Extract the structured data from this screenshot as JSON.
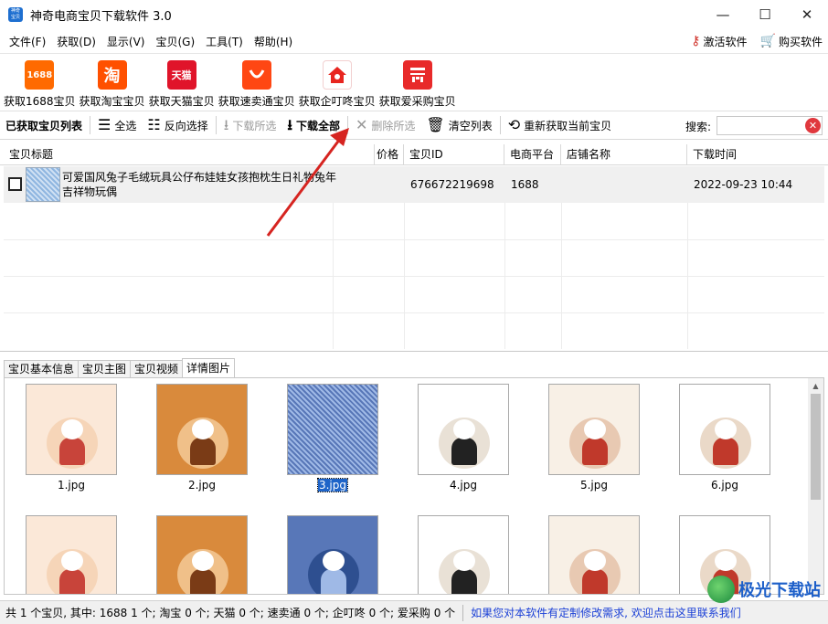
{
  "window": {
    "title": "神奇电商宝贝下载软件 3.0",
    "app_icon_text": "神奇\n宝贝",
    "minimize": "—",
    "maximize": "☐",
    "close": "✕"
  },
  "menu": {
    "items": [
      "文件(F)",
      "获取(D)",
      "显示(V)",
      "宝贝(G)",
      "工具(T)",
      "帮助(H)"
    ],
    "activate": "激活软件",
    "buy": "购买软件"
  },
  "platform_buttons": [
    {
      "label": "获取1688宝贝",
      "icon_text": "1688",
      "icon": "1688-icon",
      "color": "#ff6a00"
    },
    {
      "label": "获取淘宝宝贝",
      "icon_text": "淘",
      "icon": "taobao-icon",
      "color": "#ff5000"
    },
    {
      "label": "获取天猫宝贝",
      "icon_text": "天猫",
      "icon": "tmall-icon",
      "color": "#e0142a"
    },
    {
      "label": "获取速卖通宝贝",
      "icon_text": "",
      "icon": "aliexpress-icon",
      "color": "#ff4713"
    },
    {
      "label": "获取企叮咚宝贝",
      "icon_text": "",
      "icon": "qidingdong-icon",
      "color": "#e8251f"
    },
    {
      "label": "获取爱采购宝贝",
      "icon_text": "",
      "icon": "aicaigou-icon",
      "color": "#e82a2a"
    }
  ],
  "toolbar": {
    "list_title": "已获取宝贝列表",
    "select_all": "全选",
    "invert_select": "反向选择",
    "download_selected": "下载所选",
    "download_all": "下载全部",
    "delete_selected": "删除所选",
    "clear_list": "清空列表",
    "refetch": "重新获取当前宝贝",
    "search_label": "搜索:",
    "search_value": ""
  },
  "grid": {
    "columns": [
      "宝贝标题",
      "价格",
      "宝贝ID",
      "电商平台",
      "店铺名称",
      "下载时间"
    ],
    "rows": [
      {
        "title": "可爱国风兔子毛绒玩具公仔布娃娃女孩抱枕生日礼物兔年吉祥物玩偶",
        "price": "",
        "id": "676672219698",
        "platform": "1688",
        "shop": "",
        "time": "2022-09-23 10:44"
      }
    ]
  },
  "tabs": [
    "宝贝基本信息",
    "宝贝主图",
    "宝贝视频",
    "详情图片"
  ],
  "active_tab": "详情图片",
  "images": [
    {
      "name": "1.jpg",
      "selected": false
    },
    {
      "name": "2.jpg",
      "selected": false
    },
    {
      "name": "3.jpg",
      "selected": true
    },
    {
      "name": "4.jpg",
      "selected": false
    },
    {
      "name": "5.jpg",
      "selected": false
    },
    {
      "name": "6.jpg",
      "selected": false
    },
    {
      "name": "",
      "selected": false
    },
    {
      "name": "",
      "selected": false
    },
    {
      "name": "",
      "selected": false
    },
    {
      "name": "",
      "selected": false
    },
    {
      "name": "",
      "selected": false
    },
    {
      "name": "",
      "selected": false
    }
  ],
  "status": {
    "summary": "共 1 个宝贝, 其中: 1688 1 个; 淘宝 0 个; 天猫 0 个; 速卖通 0 个; 企叮咚 0 个; 爱采购 0 个",
    "link": "如果您对本软件有定制修改需求, 欢迎点击这里联系我们"
  },
  "watermark": "极光下载站",
  "colors": {
    "accent_red": "#d0342c",
    "selection_blue": "#1e64c8",
    "link_blue": "#1a3fd6"
  }
}
